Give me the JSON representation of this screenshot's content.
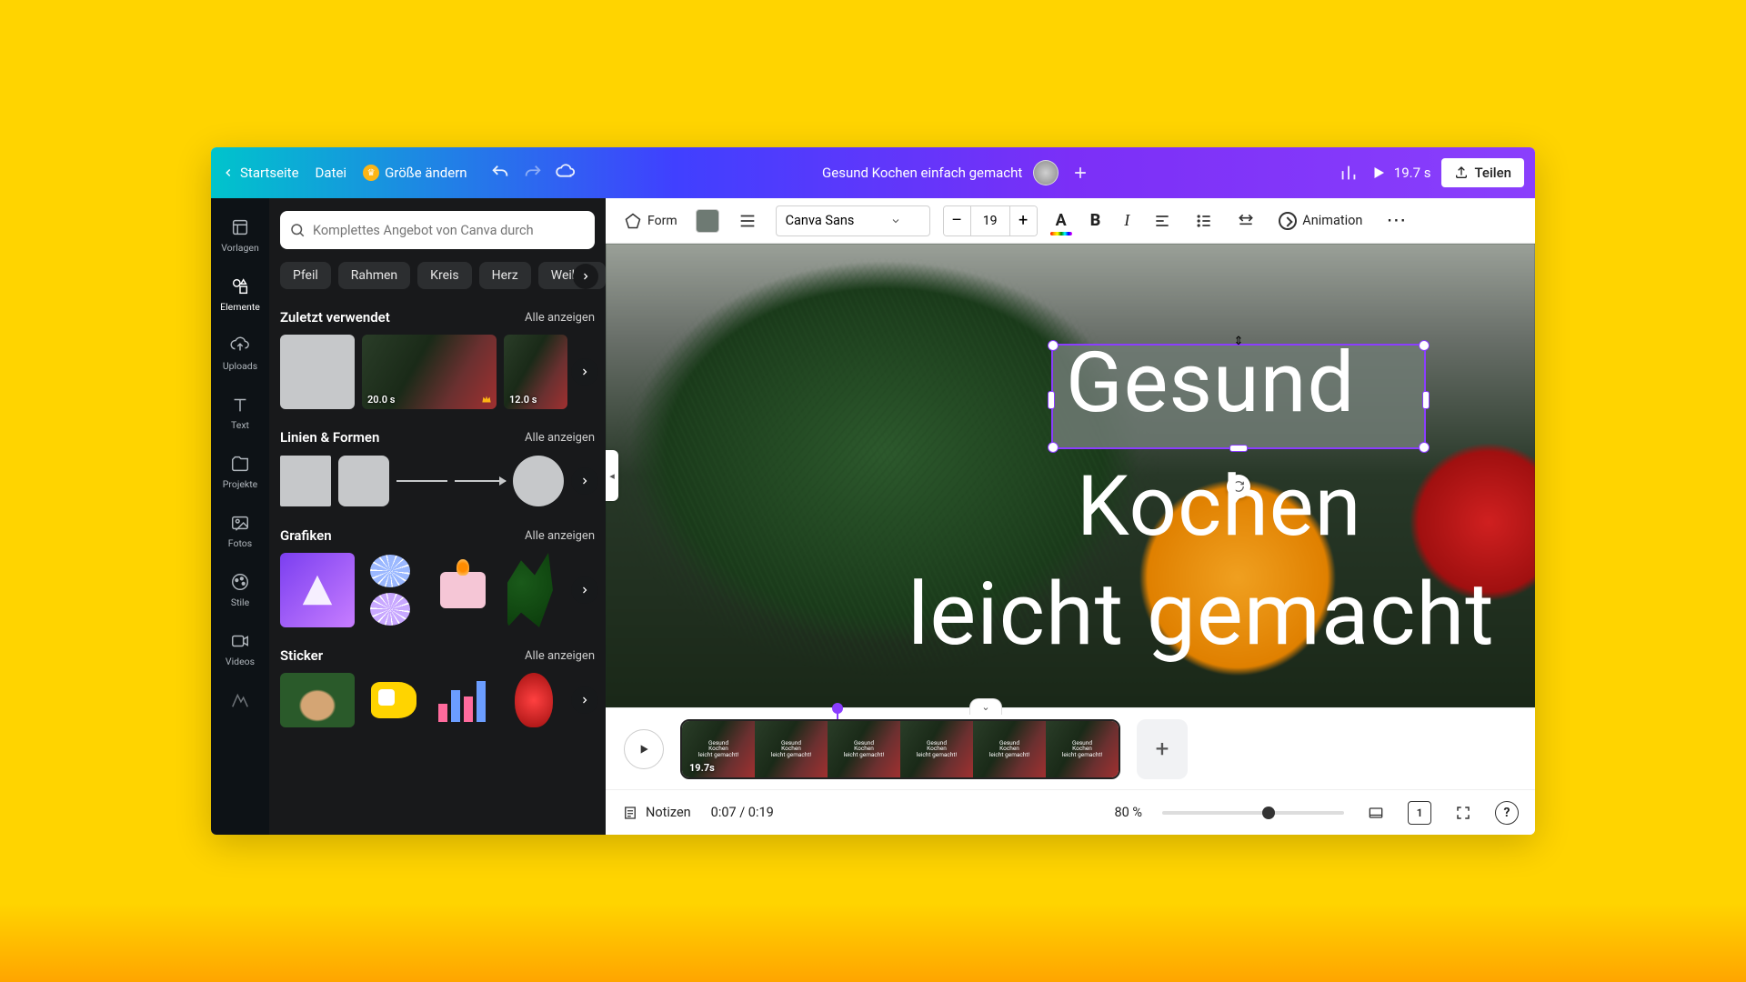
{
  "header": {
    "home": "Startseite",
    "file": "Datei",
    "resize": "Größe ändern",
    "doc_title": "Gesund Kochen einfach gemacht",
    "duration": "19.7 s",
    "share": "Teilen"
  },
  "rail": {
    "templates": "Vorlagen",
    "elements": "Elemente",
    "uploads": "Uploads",
    "text": "Text",
    "projects": "Projekte",
    "photos": "Fotos",
    "styles": "Stile",
    "videos": "Videos"
  },
  "panel": {
    "search_placeholder": "Komplettes Angebot von Canva durch",
    "chips": [
      "Pfeil",
      "Rahmen",
      "Kreis",
      "Herz",
      "Weihna"
    ],
    "show_all": "Alle anzeigen",
    "recent": {
      "title": "Zuletzt verwendet",
      "items_duration": [
        "",
        "20.0 s",
        "12.0 s"
      ]
    },
    "lines": {
      "title": "Linien & Formen"
    },
    "graphics": {
      "title": "Grafiken"
    },
    "stickers": {
      "title": "Sticker"
    }
  },
  "format_bar": {
    "form": "Form",
    "swatch_color": "#6e7a73",
    "font_name": "Canva Sans",
    "font_size": "19",
    "animation": "Animation"
  },
  "canvas": {
    "line1": "Gesund",
    "line2": "Kochen",
    "line3": "leicht gemacht"
  },
  "timeline": {
    "clip_duration": "19.7s",
    "frame_text_top": "Gesund",
    "frame_text_mid": "Kochen",
    "frame_text_bot": "leicht gemacht!"
  },
  "status": {
    "notes": "Notizen",
    "time": "0:07 / 0:19",
    "zoom": "80 %",
    "page_num": "1"
  }
}
